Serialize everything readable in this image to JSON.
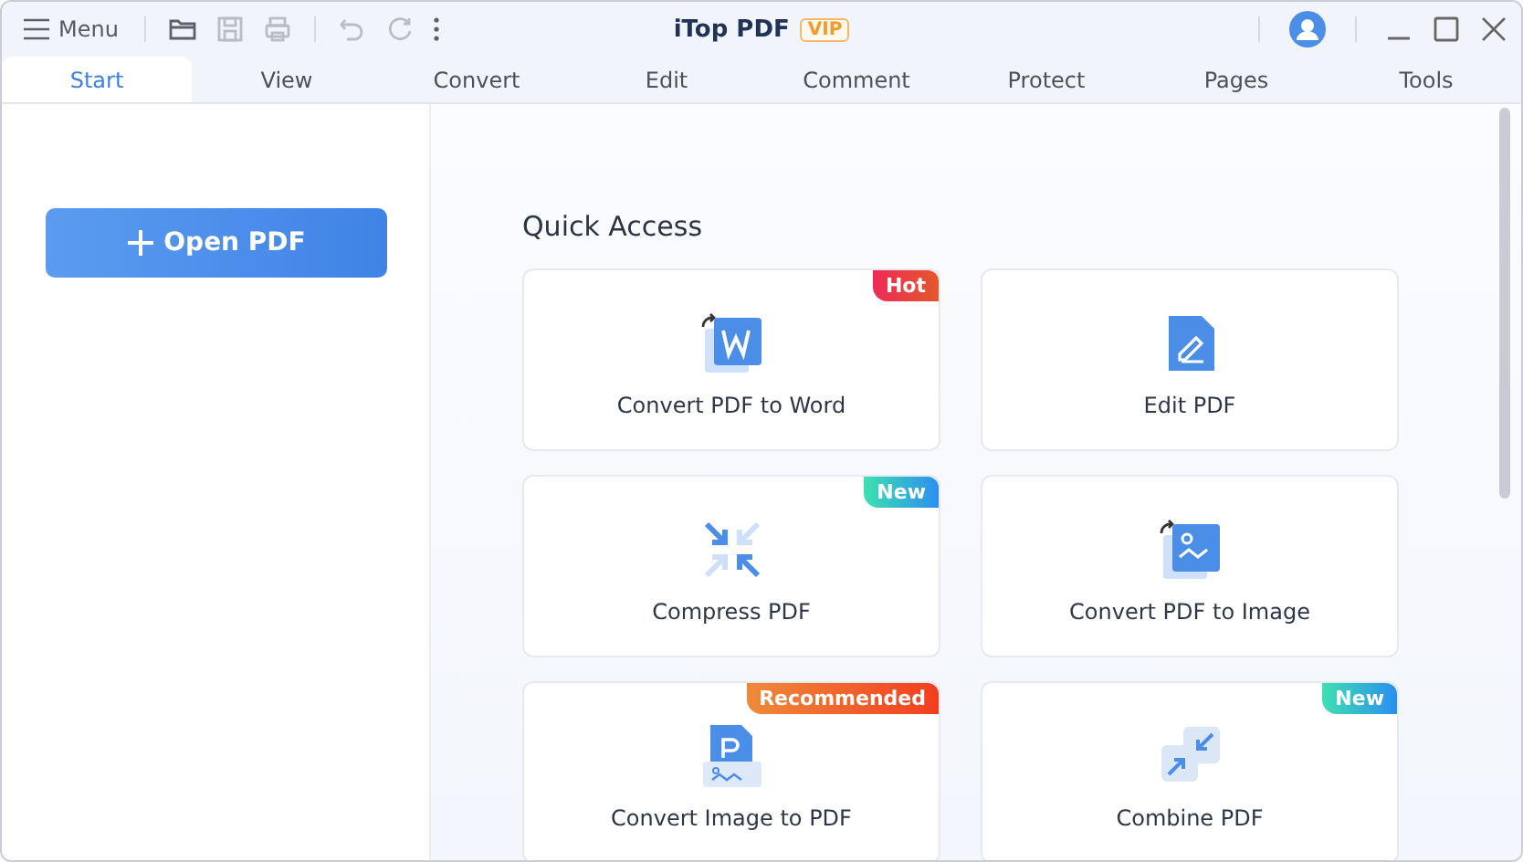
{
  "titlebar": {
    "menu": "Menu",
    "tools": [
      {
        "kind": "open",
        "disabled": false
      },
      {
        "kind": "save",
        "disabled": true
      },
      {
        "kind": "print",
        "disabled": true
      },
      {
        "kind": "undo",
        "disabled": true
      },
      {
        "kind": "redo",
        "disabled": true
      },
      {
        "kind": "more",
        "disabled": false
      }
    ],
    "app_name": "iTop PDF",
    "vip": "VIP"
  },
  "tabs": [
    {
      "label": "Start",
      "selected": true
    },
    {
      "label": "View",
      "selected": false
    },
    {
      "label": "Convert",
      "selected": false
    },
    {
      "label": "Edit",
      "selected": false
    },
    {
      "label": "Comment",
      "selected": false
    },
    {
      "label": "Protect",
      "selected": false
    },
    {
      "label": "Pages",
      "selected": false
    },
    {
      "label": "Tools",
      "selected": false
    }
  ],
  "sidebar": {
    "open_button": "Open PDF"
  },
  "quick_access": {
    "title": "Quick Access",
    "cards": [
      {
        "kind": "word",
        "label": "Convert PDF to Word",
        "badge": {
          "kind": "hot",
          "text": "Hot"
        }
      },
      {
        "kind": "edit",
        "label": "Edit PDF"
      },
      {
        "kind": "compress",
        "label": "Compress PDF",
        "badge": {
          "kind": "new",
          "text": "New"
        }
      },
      {
        "kind": "image",
        "label": "Convert PDF to Image"
      },
      {
        "kind": "image-to-pdf",
        "label": "Convert Image to PDF",
        "badge": {
          "kind": "recommended",
          "text": "Recommended"
        }
      },
      {
        "kind": "combine",
        "label": "Combine PDF",
        "badge": {
          "kind": "new",
          "text": "New"
        }
      }
    ]
  }
}
